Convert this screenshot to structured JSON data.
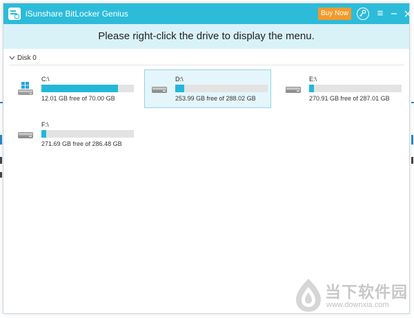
{
  "window": {
    "title": "iSunshare BitLocker Genius",
    "buy_now": "Buy Now",
    "icons": [
      "app-logo-icon",
      "key-icon",
      "menu-icon",
      "minimize-icon",
      "close-icon"
    ]
  },
  "banner": {
    "text": "Please right-click the drive to display the menu."
  },
  "disk": {
    "label": "Disk 0"
  },
  "drives": [
    {
      "label": "C:\\",
      "free_text": "12.01 GB free of 70.00 GB",
      "used_fraction": 0.83,
      "icon": "windows-drive-icon",
      "selected": false
    },
    {
      "label": "D:\\",
      "free_text": "253.99 GB free of 288.02 GB",
      "used_fraction": 0.1,
      "icon": "hard-drive-icon",
      "selected": true
    },
    {
      "label": "E:\\",
      "free_text": "270.91 GB free of 287.01 GB",
      "used_fraction": 0.05,
      "icon": "hard-drive-icon",
      "selected": false
    },
    {
      "label": "F:\\",
      "free_text": "271.69 GB free of 286.48 GB",
      "used_fraction": 0.05,
      "icon": "hard-drive-icon",
      "selected": false
    }
  ],
  "colors": {
    "titlebar": "#2cbcda",
    "banner": "#d9f2f8",
    "bar": "#23b8d8",
    "buy_now": "#f39a2b"
  },
  "watermark": {
    "brand": "当下软件园",
    "url": "www.downxia.com"
  }
}
